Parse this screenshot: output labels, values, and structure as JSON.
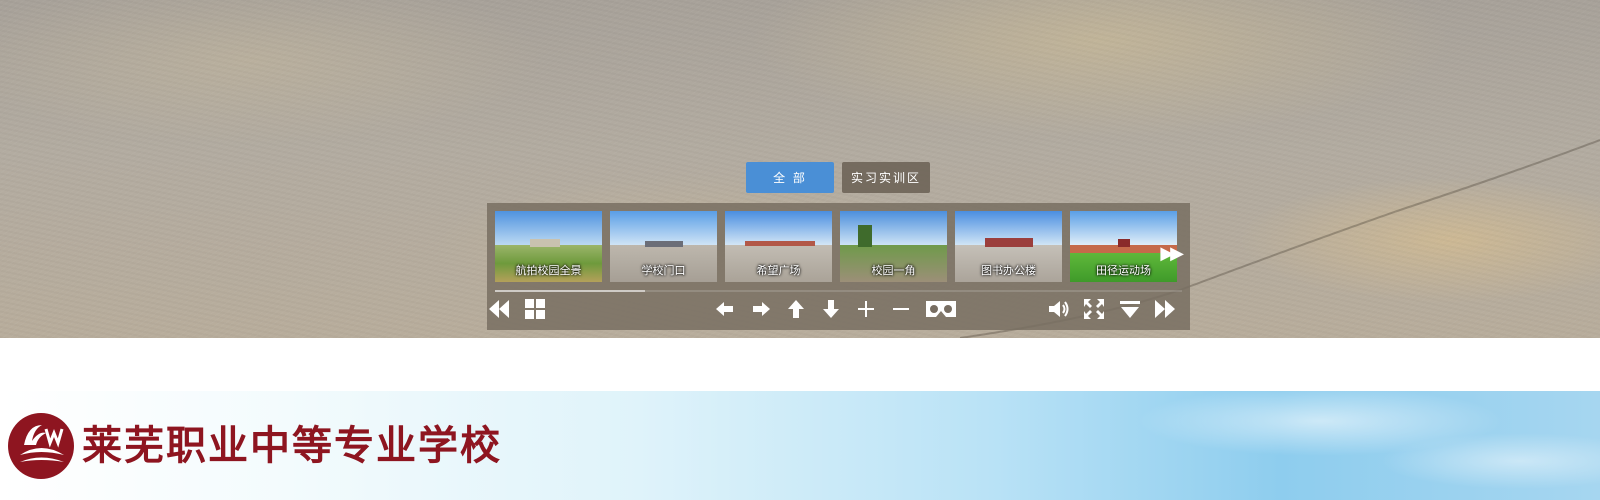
{
  "viewer": {
    "category_tabs": [
      {
        "label": "全 部",
        "active": true
      },
      {
        "label": "实习实训区",
        "active": false
      }
    ],
    "thumbnails": [
      {
        "caption": "航拍校园全景",
        "selected": false
      },
      {
        "caption": "学校门口",
        "selected": true
      },
      {
        "caption": "希望广场",
        "selected": false
      },
      {
        "caption": "校园一角",
        "selected": false
      },
      {
        "caption": "图书办公楼",
        "selected": false
      },
      {
        "caption": "田径运动场",
        "selected": false
      }
    ],
    "toolbar_icons": [
      "rewind-icon",
      "grid-icon",
      "arrow-left-icon",
      "arrow-right-icon",
      "arrow-up-icon",
      "arrow-down-icon",
      "zoom-in-icon",
      "zoom-out-icon",
      "vr-glasses-icon",
      "volume-icon",
      "fullscreen-icon",
      "collapse-icon",
      "fast-forward-icon"
    ]
  },
  "header": {
    "school_name": "莱芜职业中等专业学校",
    "brand_color": "#8e1520",
    "accent_color": "#4a8fd6"
  }
}
